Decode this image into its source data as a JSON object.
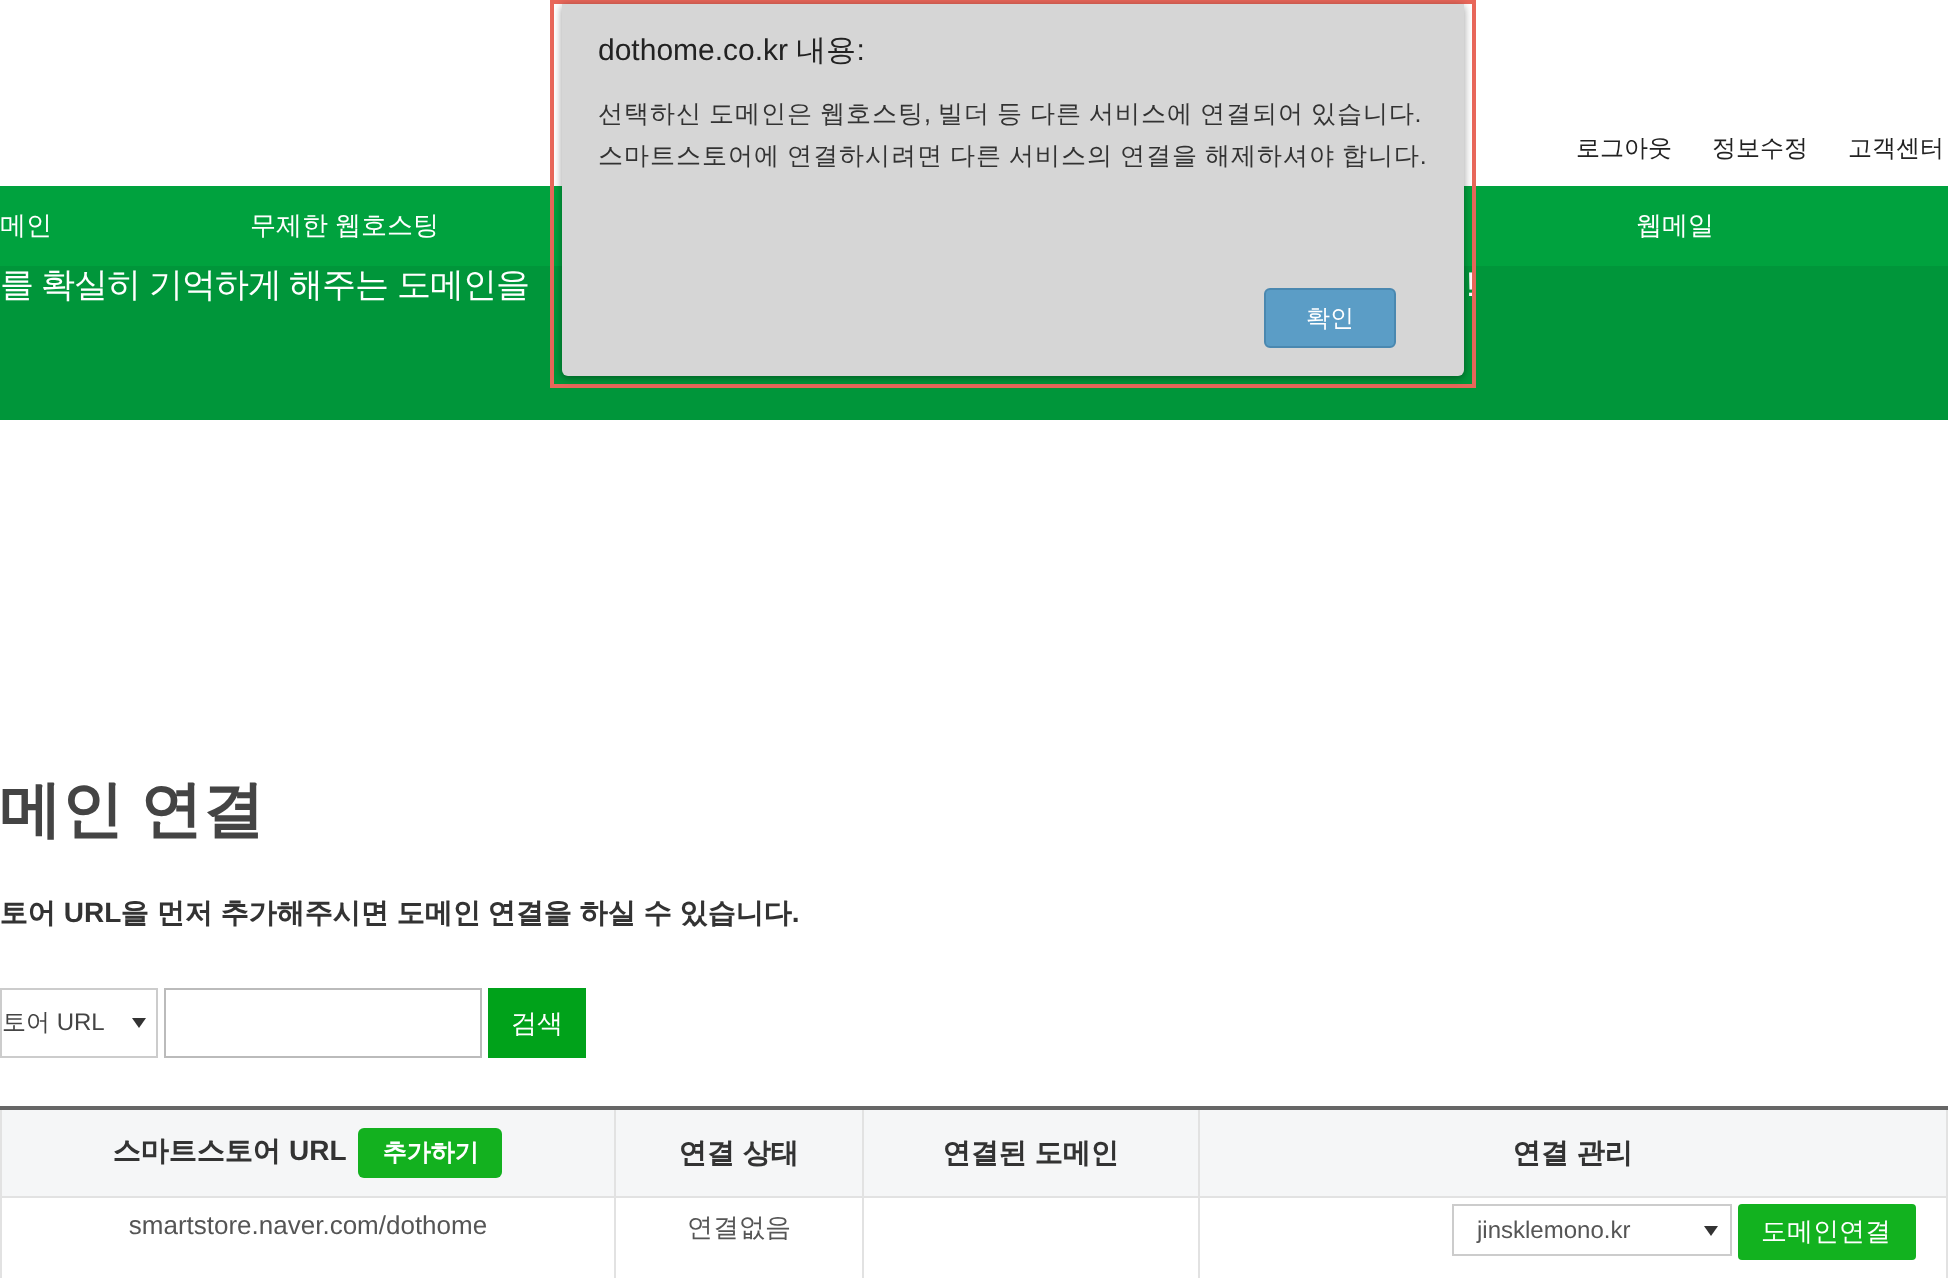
{
  "header": {
    "links": [
      "로그아웃",
      "정보수정",
      "고객센터"
    ]
  },
  "nav": {
    "items": [
      "메인",
      "무제한 웹호스팅",
      "웹메일"
    ]
  },
  "banner": {
    "text_left": "를 확실히 기억하게 해주는 도메인을",
    "text_right": "!"
  },
  "page": {
    "title": "메인 연결",
    "description": "토어 URL을 먼저 추가해주시면 도메인 연결을 하실 수 있습니다."
  },
  "search": {
    "select_value": "토어 URL",
    "button": "검색"
  },
  "table": {
    "columns": [
      "스마트스토어 URL",
      "연결 상태",
      "연결된 도메인",
      "연결 관리"
    ],
    "add_button": "추가하기",
    "rows": [
      {
        "url": "smartstore.naver.com/dothome",
        "status": "연결없음",
        "domain_select": "jinsklemono.kr",
        "connect_button": "도메인연결"
      }
    ]
  },
  "dialog": {
    "title": "dothome.co.kr 내용:",
    "message": [
      "선택하신 도메인은 웹호스팅, 빌더 등 다른 서비스에 연결되어 있습니다.",
      "스마트스토어에 연결하시려면 다른 서비스의 연결을 해제하셔야 합니다."
    ],
    "ok_button": "확인"
  }
}
